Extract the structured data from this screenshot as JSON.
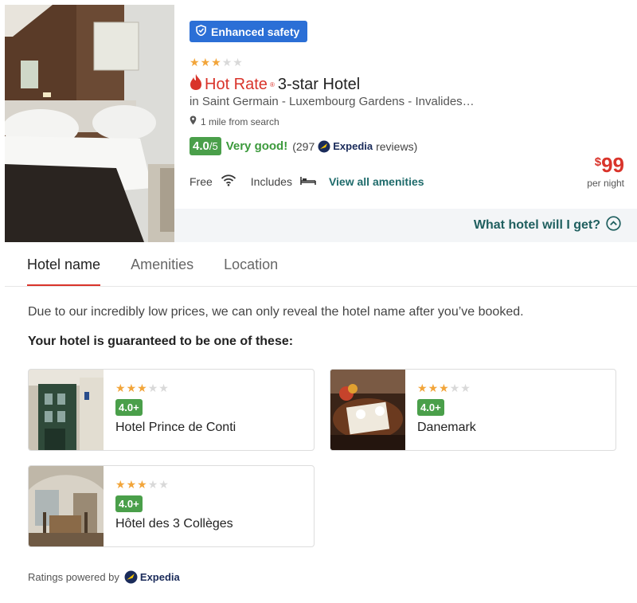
{
  "listing": {
    "badge": "Enhanced safety",
    "star_rating": 3,
    "hot_rate_label": "Hot Rate",
    "hot_rate_mark": "®",
    "title_rest": "3-star Hotel",
    "locale": "in Saint Germain - Luxembourg Gardens - Invalides…",
    "distance": "1 mile from search",
    "score": "4.0",
    "score_scale": "/5",
    "rating_text": "Very good!",
    "reviews_count": "(297",
    "reviews_suffix": "reviews)",
    "expedia_label": "Expedia",
    "amenity_free": "Free",
    "amenity_includes": "Includes",
    "view_amenities": "View all amenities",
    "price_currency": "$",
    "price_value": "99",
    "price_unit": "per night",
    "what_hotel": "What hotel will I get?"
  },
  "tabs": [
    {
      "label": "Hotel name",
      "active": true
    },
    {
      "label": "Amenities",
      "active": false
    },
    {
      "label": "Location",
      "active": false
    }
  ],
  "description": "Due to our incredibly low prices, we can only reveal the hotel name after you’ve booked.",
  "guarantee": "Your hotel is guaranteed to be one of these:",
  "hotels": [
    {
      "name": "Hotel Prince de Conti",
      "score": "4.0+",
      "stars": 3
    },
    {
      "name": "Danemark",
      "score": "4.0+",
      "stars": 3
    },
    {
      "name": "Hôtel des 3 Collèges",
      "score": "4.0+",
      "stars": 3
    }
  ],
  "footer": {
    "powered_by": "Ratings powered by",
    "expedia_label": "Expedia"
  },
  "colors": {
    "accent_red": "#d9342b",
    "badge_blue": "#2b6fd6",
    "rating_green": "#4a9f4a",
    "link_teal": "#1f6b6b"
  }
}
